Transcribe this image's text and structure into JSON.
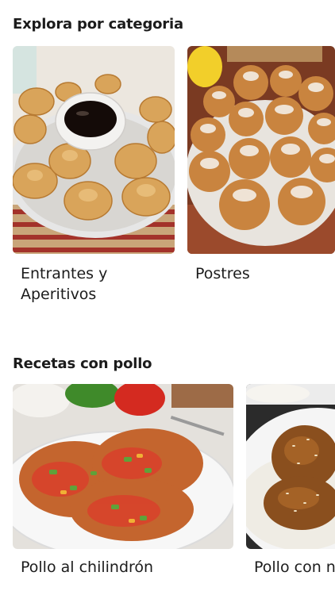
{
  "explore": {
    "title": "Explora por categoria",
    "cards": [
      {
        "label_line1": "Entrantes y",
        "label_line2": "Aperitivos",
        "image": "fried-wontons-with-dipping-sauce"
      },
      {
        "label_line1": "Postres",
        "image": "powdered-sugar-fritters"
      }
    ]
  },
  "chicken": {
    "title": "Recetas con pollo",
    "cards": [
      {
        "label": "Pollo al chilindrón",
        "image": "chicken-with-pepper-tomato-sauce"
      },
      {
        "label": "Pollo con n",
        "image": "glazed-sesame-chicken-with-rice"
      }
    ]
  },
  "colors": {
    "text": "#1c1c1c",
    "background": "#ffffff"
  }
}
